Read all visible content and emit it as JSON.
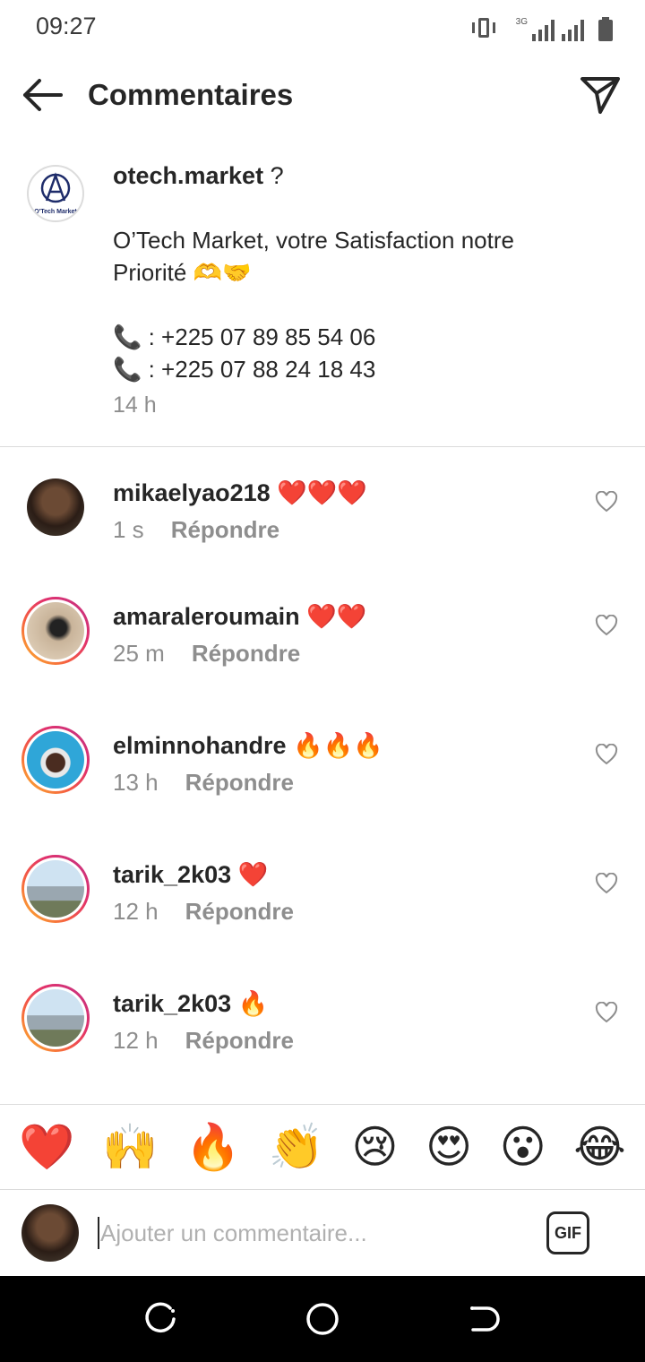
{
  "status_bar": {
    "time": "09:27",
    "network": "3G"
  },
  "header": {
    "title": "Commentaires"
  },
  "caption": {
    "username": "otech.market",
    "username_suffix": " ?",
    "logo_text": "O'Tech Market",
    "text_line1": "O’Tech Market, votre Satisfaction notre",
    "text_line2": "Priorité 🫶🤝",
    "phone1": "📞 : +225 07 89 85 54 06",
    "phone2": "📞 : +225 07 88 24 18 43",
    "time": "14 h"
  },
  "comments": [
    {
      "username": "mikaelyao218",
      "emoji": "❤️❤️❤️",
      "time": "1 s",
      "reply_label": "Répondre",
      "ring": false
    },
    {
      "username": "amaraleroumain",
      "emoji": "❤️❤️",
      "time": "25 m",
      "reply_label": "Répondre",
      "ring": true
    },
    {
      "username": "elminnohandre",
      "emoji": "🔥🔥🔥",
      "time": "13 h",
      "reply_label": "Répondre",
      "ring": true
    },
    {
      "username": "tarik_2k03",
      "emoji": "❤️",
      "time": "12 h",
      "reply_label": "Répondre",
      "ring": true
    },
    {
      "username": "tarik_2k03",
      "emoji": "🔥",
      "time": "12 h",
      "reply_label": "Répondre",
      "ring": true
    }
  ],
  "quick_emojis": [
    "❤️",
    "🙌",
    "🔥",
    "👏",
    "😢",
    "😍",
    "😮",
    "😂"
  ],
  "input": {
    "placeholder": "Ajouter un commentaire...",
    "gif_label": "GIF"
  },
  "colors": {
    "ring_start": "#fdbb2d",
    "ring_end": "#c13584",
    "meta_gray": "#8e8e8e",
    "divider": "#dbdbdb"
  },
  "icons": {
    "back": "arrow-left-icon",
    "send": "paper-plane-icon",
    "like": "heart-outline-icon",
    "nav_recents": "recents-icon",
    "nav_home": "home-circle-icon",
    "nav_back": "back-nav-icon"
  }
}
